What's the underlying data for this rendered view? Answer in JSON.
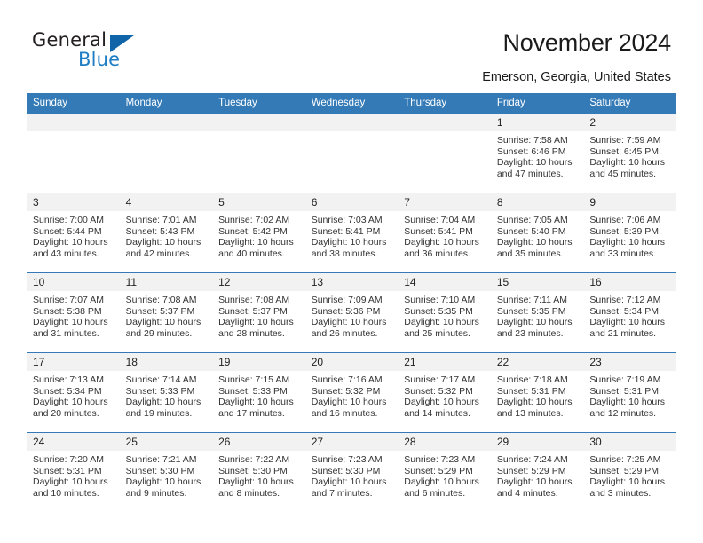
{
  "logo": {
    "word1": "General",
    "word2": "Blue",
    "triangle_icon": "blue-triangle-icon",
    "accent_color": "#1065a8"
  },
  "header": {
    "title": "November 2024",
    "subtitle": "Emerson, Georgia, United States"
  },
  "calendar": {
    "header_bg": "#337ab7",
    "daynum_bg": "#f2f2f2",
    "weekday_headers": [
      "Sunday",
      "Monday",
      "Tuesday",
      "Wednesday",
      "Thursday",
      "Friday",
      "Saturday"
    ],
    "weeks": [
      [
        {
          "day": "",
          "blank": true
        },
        {
          "day": "",
          "blank": true
        },
        {
          "day": "",
          "blank": true
        },
        {
          "day": "",
          "blank": true
        },
        {
          "day": "",
          "blank": true
        },
        {
          "day": "1",
          "sunrise": "Sunrise: 7:58 AM",
          "sunset": "Sunset: 6:46 PM",
          "daylight": "Daylight: 10 hours and 47 minutes."
        },
        {
          "day": "2",
          "sunrise": "Sunrise: 7:59 AM",
          "sunset": "Sunset: 6:45 PM",
          "daylight": "Daylight: 10 hours and 45 minutes."
        }
      ],
      [
        {
          "day": "3",
          "sunrise": "Sunrise: 7:00 AM",
          "sunset": "Sunset: 5:44 PM",
          "daylight": "Daylight: 10 hours and 43 minutes."
        },
        {
          "day": "4",
          "sunrise": "Sunrise: 7:01 AM",
          "sunset": "Sunset: 5:43 PM",
          "daylight": "Daylight: 10 hours and 42 minutes."
        },
        {
          "day": "5",
          "sunrise": "Sunrise: 7:02 AM",
          "sunset": "Sunset: 5:42 PM",
          "daylight": "Daylight: 10 hours and 40 minutes."
        },
        {
          "day": "6",
          "sunrise": "Sunrise: 7:03 AM",
          "sunset": "Sunset: 5:41 PM",
          "daylight": "Daylight: 10 hours and 38 minutes."
        },
        {
          "day": "7",
          "sunrise": "Sunrise: 7:04 AM",
          "sunset": "Sunset: 5:41 PM",
          "daylight": "Daylight: 10 hours and 36 minutes."
        },
        {
          "day": "8",
          "sunrise": "Sunrise: 7:05 AM",
          "sunset": "Sunset: 5:40 PM",
          "daylight": "Daylight: 10 hours and 35 minutes."
        },
        {
          "day": "9",
          "sunrise": "Sunrise: 7:06 AM",
          "sunset": "Sunset: 5:39 PM",
          "daylight": "Daylight: 10 hours and 33 minutes."
        }
      ],
      [
        {
          "day": "10",
          "sunrise": "Sunrise: 7:07 AM",
          "sunset": "Sunset: 5:38 PM",
          "daylight": "Daylight: 10 hours and 31 minutes."
        },
        {
          "day": "11",
          "sunrise": "Sunrise: 7:08 AM",
          "sunset": "Sunset: 5:37 PM",
          "daylight": "Daylight: 10 hours and 29 minutes."
        },
        {
          "day": "12",
          "sunrise": "Sunrise: 7:08 AM",
          "sunset": "Sunset: 5:37 PM",
          "daylight": "Daylight: 10 hours and 28 minutes."
        },
        {
          "day": "13",
          "sunrise": "Sunrise: 7:09 AM",
          "sunset": "Sunset: 5:36 PM",
          "daylight": "Daylight: 10 hours and 26 minutes."
        },
        {
          "day": "14",
          "sunrise": "Sunrise: 7:10 AM",
          "sunset": "Sunset: 5:35 PM",
          "daylight": "Daylight: 10 hours and 25 minutes."
        },
        {
          "day": "15",
          "sunrise": "Sunrise: 7:11 AM",
          "sunset": "Sunset: 5:35 PM",
          "daylight": "Daylight: 10 hours and 23 minutes."
        },
        {
          "day": "16",
          "sunrise": "Sunrise: 7:12 AM",
          "sunset": "Sunset: 5:34 PM",
          "daylight": "Daylight: 10 hours and 21 minutes."
        }
      ],
      [
        {
          "day": "17",
          "sunrise": "Sunrise: 7:13 AM",
          "sunset": "Sunset: 5:34 PM",
          "daylight": "Daylight: 10 hours and 20 minutes."
        },
        {
          "day": "18",
          "sunrise": "Sunrise: 7:14 AM",
          "sunset": "Sunset: 5:33 PM",
          "daylight": "Daylight: 10 hours and 19 minutes."
        },
        {
          "day": "19",
          "sunrise": "Sunrise: 7:15 AM",
          "sunset": "Sunset: 5:33 PM",
          "daylight": "Daylight: 10 hours and 17 minutes."
        },
        {
          "day": "20",
          "sunrise": "Sunrise: 7:16 AM",
          "sunset": "Sunset: 5:32 PM",
          "daylight": "Daylight: 10 hours and 16 minutes."
        },
        {
          "day": "21",
          "sunrise": "Sunrise: 7:17 AM",
          "sunset": "Sunset: 5:32 PM",
          "daylight": "Daylight: 10 hours and 14 minutes."
        },
        {
          "day": "22",
          "sunrise": "Sunrise: 7:18 AM",
          "sunset": "Sunset: 5:31 PM",
          "daylight": "Daylight: 10 hours and 13 minutes."
        },
        {
          "day": "23",
          "sunrise": "Sunrise: 7:19 AM",
          "sunset": "Sunset: 5:31 PM",
          "daylight": "Daylight: 10 hours and 12 minutes."
        }
      ],
      [
        {
          "day": "24",
          "sunrise": "Sunrise: 7:20 AM",
          "sunset": "Sunset: 5:31 PM",
          "daylight": "Daylight: 10 hours and 10 minutes."
        },
        {
          "day": "25",
          "sunrise": "Sunrise: 7:21 AM",
          "sunset": "Sunset: 5:30 PM",
          "daylight": "Daylight: 10 hours and 9 minutes."
        },
        {
          "day": "26",
          "sunrise": "Sunrise: 7:22 AM",
          "sunset": "Sunset: 5:30 PM",
          "daylight": "Daylight: 10 hours and 8 minutes."
        },
        {
          "day": "27",
          "sunrise": "Sunrise: 7:23 AM",
          "sunset": "Sunset: 5:30 PM",
          "daylight": "Daylight: 10 hours and 7 minutes."
        },
        {
          "day": "28",
          "sunrise": "Sunrise: 7:23 AM",
          "sunset": "Sunset: 5:29 PM",
          "daylight": "Daylight: 10 hours and 6 minutes."
        },
        {
          "day": "29",
          "sunrise": "Sunrise: 7:24 AM",
          "sunset": "Sunset: 5:29 PM",
          "daylight": "Daylight: 10 hours and 4 minutes."
        },
        {
          "day": "30",
          "sunrise": "Sunrise: 7:25 AM",
          "sunset": "Sunset: 5:29 PM",
          "daylight": "Daylight: 10 hours and 3 minutes."
        }
      ]
    ]
  }
}
